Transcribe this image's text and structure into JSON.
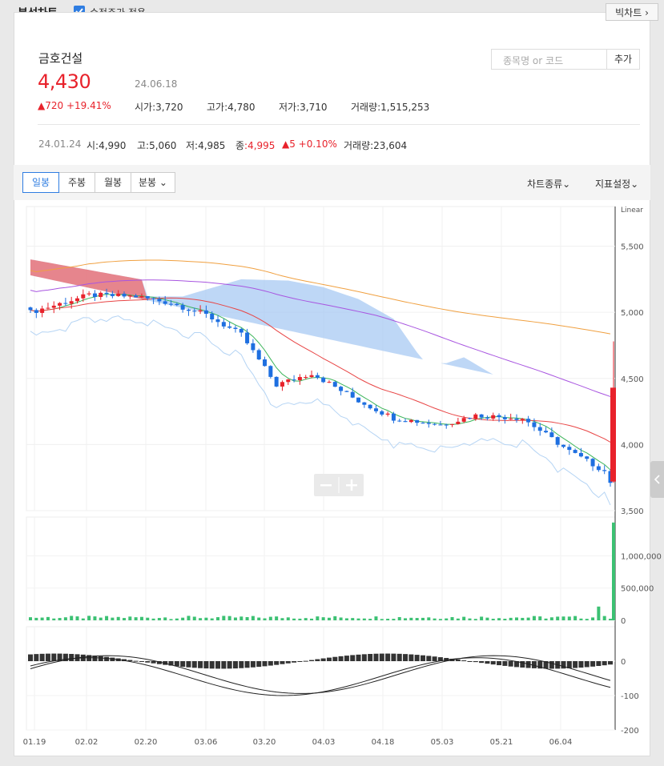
{
  "header": {
    "title": "분석차트",
    "adjusted_label": "수정주가 적용",
    "bigchart_label": "빅차트"
  },
  "stock": {
    "name": "금호건설",
    "price": "4,430",
    "date": "24.06.18",
    "change": "▲720 +19.41%",
    "open_label": "시가",
    "open": ":3,720",
    "high_label": "고가",
    "high": ":4,780",
    "low_label": "저가",
    "low": ":3,710",
    "volume_label": "거래량",
    "volume": ":1,515,253"
  },
  "search": {
    "placeholder": "종목명 or 코드",
    "add_label": "추가"
  },
  "hover": {
    "date": "24.01.24",
    "open_label": "시",
    "open": ":4,990",
    "high_label": "고",
    "high": ":5,060",
    "low_label": "저",
    "low": ":4,985",
    "close_label": "종",
    "close": ":4,995",
    "change": "▲5 +0.10%",
    "volume_label": "거래량",
    "volume": ":23,604"
  },
  "tabs": [
    {
      "label": "일봉"
    },
    {
      "label": "주봉"
    },
    {
      "label": "월봉"
    },
    {
      "label": "분봉"
    }
  ],
  "toolbar": {
    "chart_type": "차트종류",
    "indicator": "지표설정"
  },
  "colors": {
    "up": "#e8222b",
    "down": "#1e6fe0",
    "volume": "#3cc173",
    "cloud_bull": "#f36a6a",
    "cloud_bear": "#a8c9f3"
  },
  "chart_data": {
    "type": "candlestick",
    "scale_label": "Linear",
    "price_axis": [
      "5,500",
      "5,000",
      "4,500",
      "4,000",
      "3,500"
    ],
    "price_ticks": [
      5500,
      5000,
      4500,
      4000,
      3500
    ],
    "ylim": [
      3500,
      5800
    ],
    "volume_axis": [
      "1,000,000",
      "500,000",
      "0"
    ],
    "volume_ticks": [
      1000000,
      500000,
      0
    ],
    "macd_axis": [
      "0",
      "-100",
      "-200"
    ],
    "macd_ticks": [
      0,
      -100,
      -200
    ],
    "x_labels": [
      "01.19",
      "02.02",
      "02.20",
      "03.06",
      "03.20",
      "04.03",
      "04.18",
      "05.03",
      "05.21",
      "06.04"
    ],
    "last": {
      "open": 3720,
      "high": 4780,
      "low": 3710,
      "close": 4430,
      "volume": 1515253
    }
  }
}
